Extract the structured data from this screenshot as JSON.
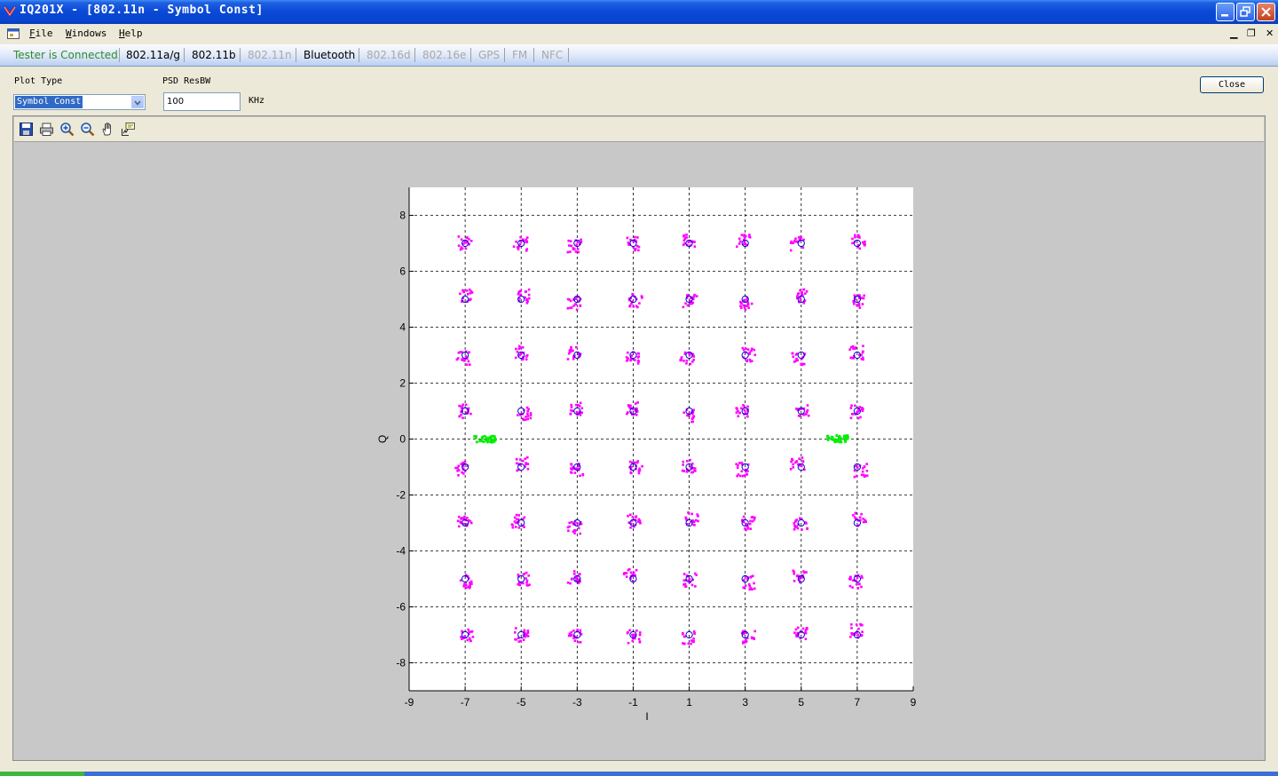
{
  "window": {
    "title": "IQ201X - [802.11n - Symbol Const]"
  },
  "menu": {
    "items": [
      "File",
      "Windows",
      "Help"
    ]
  },
  "tabs": {
    "status": "Tester is Connected",
    "items": [
      {
        "label": "802.11a/g",
        "enabled": true
      },
      {
        "label": "802.11b",
        "enabled": true
      },
      {
        "label": "802.11n",
        "enabled": false
      },
      {
        "label": "Bluetooth",
        "enabled": true
      },
      {
        "label": "802.16d",
        "enabled": false
      },
      {
        "label": "802.16e",
        "enabled": false
      },
      {
        "label": "GPS",
        "enabled": false
      },
      {
        "label": "FM",
        "enabled": false
      },
      {
        "label": "NFC",
        "enabled": false
      }
    ]
  },
  "controls": {
    "plot_type_label": "Plot Type",
    "plot_type_value": "Symbol Const",
    "psd_label": "PSD ResBW",
    "psd_value": "100",
    "psd_unit": "KHz",
    "close_label": "Close"
  },
  "toolbar_icons": [
    "save-icon",
    "print-icon",
    "zoom-in-icon",
    "zoom-out-icon",
    "pan-hand-icon",
    "data-cursor-icon"
  ],
  "colors": {
    "data_points": "#ff00ff",
    "pilot_points": "#00ee00",
    "reference_markers": "#0000cc",
    "status_text": "#2e8b2e"
  },
  "chart_data": {
    "type": "scatter",
    "title": "",
    "xlabel": "I",
    "ylabel": "Q",
    "xlim": [
      -9,
      9
    ],
    "ylim": [
      -9,
      9
    ],
    "xticks": [
      -9,
      -7,
      -5,
      -3,
      -1,
      1,
      3,
      5,
      7,
      9
    ],
    "yticks": [
      -8,
      -6,
      -4,
      -2,
      0,
      2,
      4,
      6,
      8
    ],
    "grid": true,
    "grid_x": [
      -7,
      -5,
      -3,
      -1,
      1,
      3,
      5,
      7
    ],
    "grid_y": [
      -8,
      -6,
      -4,
      -2,
      0,
      2,
      4,
      6,
      8
    ],
    "series": [
      {
        "role": "reference",
        "marker": "circle",
        "levels": [
          -7,
          -5,
          -3,
          -1,
          1,
          3,
          5,
          7
        ],
        "note_levels_apply_to": "both I and Q (64-QAM grid)"
      },
      {
        "role": "data",
        "marker": "dot",
        "levels": [
          -7,
          -5,
          -3,
          -1,
          1,
          3,
          5,
          7
        ],
        "spread": 0.35
      },
      {
        "role": "pilot",
        "marker": "dot",
        "centers": [
          [
            -6.3,
            0
          ],
          [
            6.3,
            0
          ]
        ],
        "spread_x": 0.35,
        "spread_y": 0.12
      }
    ]
  }
}
